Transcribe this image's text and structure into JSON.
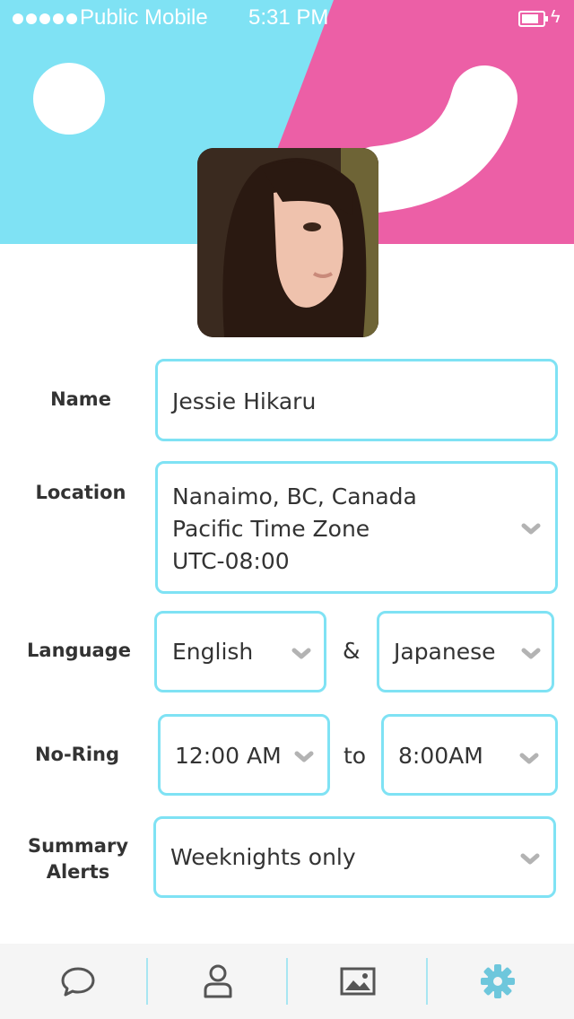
{
  "status_bar": {
    "carrier": "Public Mobile",
    "time": "5:31 PM"
  },
  "colors": {
    "header_blue": "#7fe2f4",
    "header_pink": "#ec5fa6",
    "field_border": "#7fe2f4",
    "active_tab": "#6ec7dc",
    "inactive_tab": "#555555"
  },
  "profile": {
    "avatar": "profile-photo"
  },
  "form": {
    "name": {
      "label": "Name",
      "value": "Jessie Hikaru"
    },
    "location": {
      "label": "Location",
      "lines": [
        "Nanaimo, BC, Canada",
        "Pacific Time Zone",
        "UTC-08:00"
      ]
    },
    "language": {
      "label": "Language",
      "first": "English",
      "separator": "&",
      "second": "Japanese"
    },
    "no_ring": {
      "label": "No-Ring",
      "from": "12:00 AM",
      "separator": "to",
      "to": "8:00AM"
    },
    "summary_alerts": {
      "label_line1": "Summary",
      "label_line2": "Alerts",
      "value": "Weeknights only"
    }
  },
  "tabbar": {
    "tabs": [
      {
        "icon": "chat-bubble-icon",
        "active": false
      },
      {
        "icon": "profile-icon",
        "active": false
      },
      {
        "icon": "image-icon",
        "active": false
      },
      {
        "icon": "gear-icon",
        "active": true
      }
    ]
  }
}
